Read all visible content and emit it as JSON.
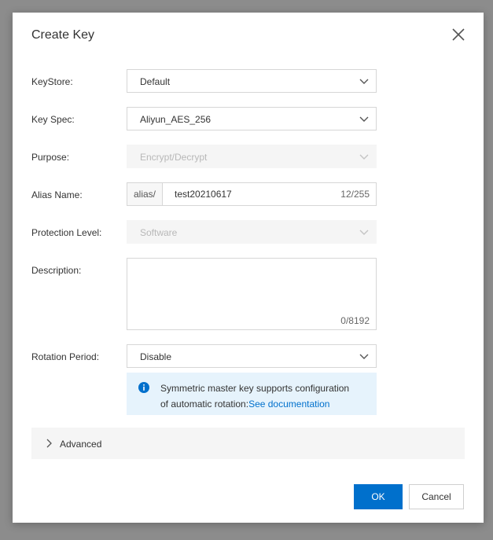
{
  "dialog": {
    "title": "Create Key"
  },
  "form": {
    "keystore": {
      "label": "KeyStore:",
      "value": "Default"
    },
    "key_spec": {
      "label": "Key Spec:",
      "value": "Aliyun_AES_256"
    },
    "purpose": {
      "label": "Purpose:",
      "value": "Encrypt/Decrypt"
    },
    "alias": {
      "label": "Alias Name:",
      "prefix": "alias/",
      "value": "test20210617",
      "count": "12/255"
    },
    "protection": {
      "label": "Protection Level:",
      "value": "Software"
    },
    "description": {
      "label": "Description:",
      "count": "0/8192"
    },
    "rotation": {
      "label": "Rotation Period:",
      "value": "Disable"
    }
  },
  "info": {
    "line1": "Symmetric master key supports configuration",
    "line2": "of automatic rotation:",
    "link": "See documentation"
  },
  "advanced": {
    "label": "Advanced"
  },
  "buttons": {
    "ok": "OK",
    "cancel": "Cancel"
  },
  "colors": {
    "primary": "#0070cc",
    "info_bg": "#e6f3fc"
  }
}
